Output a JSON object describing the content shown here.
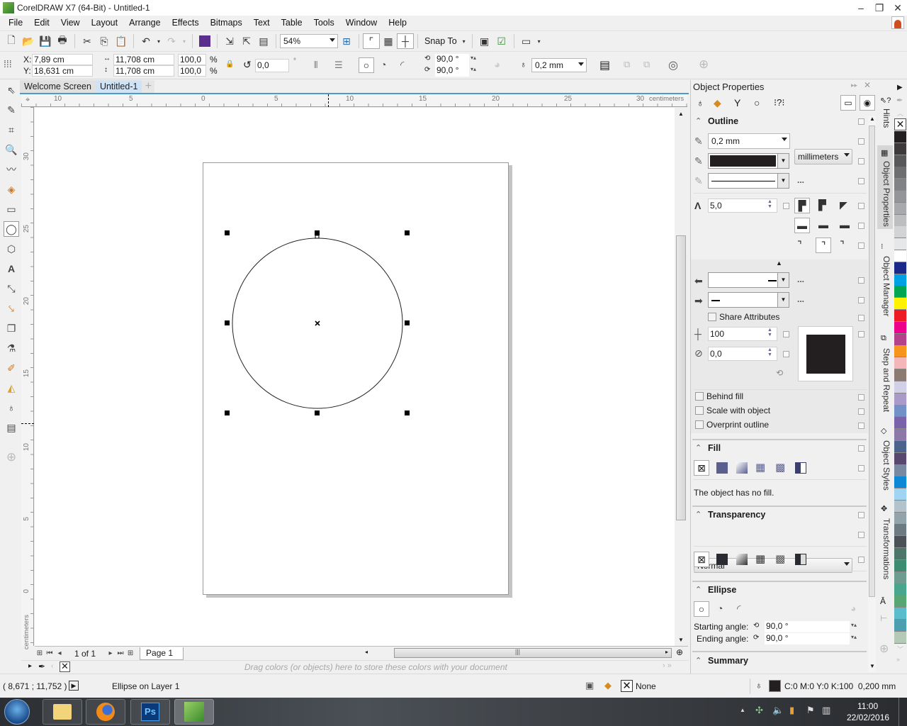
{
  "window": {
    "title": "CorelDRAW X7 (64-Bit) - Untitled-1",
    "minimize": "–",
    "restore": "❐",
    "close": "✕"
  },
  "menu": [
    "File",
    "Edit",
    "View",
    "Layout",
    "Arrange",
    "Effects",
    "Bitmaps",
    "Text",
    "Table",
    "Tools",
    "Window",
    "Help"
  ],
  "toolbar": {
    "zoom_level": "54%",
    "snap_to_label": "Snap To"
  },
  "property_bar": {
    "x_label": "X:",
    "x_value": "7,89 cm",
    "y_label": "Y:",
    "y_value": "18,631 cm",
    "width_value": "11,708 cm",
    "height_value": "11,708 cm",
    "scale_w": "100,0",
    "scale_h": "100,0",
    "percent": "%",
    "rotation": "0,0",
    "degree": "°",
    "start_angle": "90,0 °",
    "end_angle": "90,0 °",
    "outline_width": "0,2 mm"
  },
  "doc_tabs": [
    {
      "label": "Welcome Screen",
      "active": false
    },
    {
      "label": "Untitled-1",
      "active": true
    }
  ],
  "rulers": {
    "unit": "centimeters",
    "h_ticks": [
      "10",
      "5",
      "0",
      "5",
      "10",
      "15",
      "20",
      "25",
      "30"
    ],
    "v_ticks": [
      "30",
      "25",
      "20",
      "15",
      "10",
      "5",
      "0"
    ]
  },
  "page_nav": {
    "counter": "1 of 1",
    "page_tab": "Page 1"
  },
  "doc_palette_hint": "Drag colors (or objects) here to store these colors with your document",
  "docker": {
    "title": "Object Properties",
    "outline": {
      "title": "Outline",
      "width": "0,2 mm",
      "units": "millimeters",
      "color": "#231f20",
      "miter_limit": "5,0",
      "share_attributes": "Share Attributes",
      "stretch": "100",
      "angle": "0,0",
      "behind_fill": "Behind fill",
      "scale_with_object": "Scale with object",
      "overprint_outline": "Overprint outline",
      "more": "..."
    },
    "fill": {
      "title": "Fill",
      "status": "The object has no fill."
    },
    "transparency": {
      "title": "Transparency",
      "mode": "Normal"
    },
    "ellipse": {
      "title": "Ellipse",
      "starting_label": "Starting angle:",
      "starting_value": "90,0 °",
      "ending_label": "Ending angle:",
      "ending_value": "90,0 °"
    },
    "summary": {
      "title": "Summary"
    }
  },
  "side_tabs": [
    "Hints",
    "Object Properties",
    "Object Manager",
    "Step and Repeat",
    "Object Styles",
    "Transformations"
  ],
  "palette_colors": [
    "#231f20",
    "#3e3a3b",
    "#58585a",
    "#6d6e70",
    "#808285",
    "#939598",
    "#a7a9ac",
    "#bcbec0",
    "#d1d3d4",
    "#e6e7e8",
    "#ffffff",
    "#1b2a8a",
    "#00a0e4",
    "#00a651",
    "#fff200",
    "#ed1c24",
    "#ec008c",
    "#b3428a",
    "#f7941d",
    "#f4b6b9",
    "#8c7b70",
    "#d2d0e6",
    "#a99ac9",
    "#7490c9",
    "#7b63ab",
    "#8c79a8",
    "#4c648d",
    "#58476e",
    "#7888a0",
    "#0d88d6",
    "#a1d4f2",
    "#b3c3cc",
    "#93a3ab",
    "#6e7a82",
    "#4a5157",
    "#4e7569",
    "#3d8c72",
    "#6e9c91",
    "#47a68c",
    "#58a673",
    "#5bbdcc",
    "#4d9eaf",
    "#b4c9b6"
  ],
  "status": {
    "coords": "( 8,671 ; 11,752 )",
    "object_info": "Ellipse on Layer 1",
    "fill_label": "None",
    "outline_info": "C:0 M:0 Y:0 K:100  0,200 mm",
    "outline_color": "#231f20"
  },
  "taskbar": {
    "time": "11:00",
    "date": "22/02/2016",
    "apps": [
      "start",
      "explorer",
      "firefox",
      "photoshop",
      "coreldraw"
    ]
  }
}
